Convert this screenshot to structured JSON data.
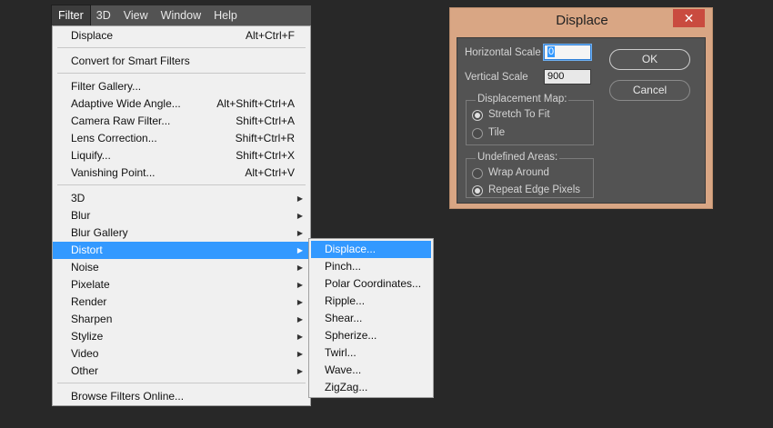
{
  "menubar": {
    "items": [
      "Filter",
      "3D",
      "View",
      "Window",
      "Help"
    ],
    "active": "Filter"
  },
  "filter_menu": {
    "last_filter": {
      "label": "Displace",
      "shortcut": "Alt+Ctrl+F"
    },
    "convert": {
      "label": "Convert for Smart Filters"
    },
    "group1": [
      {
        "label": "Filter Gallery...",
        "shortcut": ""
      },
      {
        "label": "Adaptive Wide Angle...",
        "shortcut": "Alt+Shift+Ctrl+A"
      },
      {
        "label": "Camera Raw Filter...",
        "shortcut": "Shift+Ctrl+A"
      },
      {
        "label": "Lens Correction...",
        "shortcut": "Shift+Ctrl+R"
      },
      {
        "label": "Liquify...",
        "shortcut": "Shift+Ctrl+X"
      },
      {
        "label": "Vanishing Point...",
        "shortcut": "Alt+Ctrl+V"
      }
    ],
    "submenus": [
      "3D",
      "Blur",
      "Blur Gallery",
      "Distort",
      "Noise",
      "Pixelate",
      "Render",
      "Sharpen",
      "Stylize",
      "Video",
      "Other"
    ],
    "highlighted": "Distort",
    "browse": {
      "label": "Browse Filters Online..."
    }
  },
  "distort_submenu": {
    "items": [
      "Displace...",
      "Pinch...",
      "Polar Coordinates...",
      "Ripple...",
      "Shear...",
      "Spherize...",
      "Twirl...",
      "Wave...",
      "ZigZag..."
    ],
    "highlighted": "Displace..."
  },
  "dialog": {
    "title": "Displace",
    "close_glyph": "✕",
    "horizontal_scale_label": "Horizontal Scale",
    "horizontal_scale_value": "0",
    "vertical_scale_label": "Vertical Scale",
    "vertical_scale_value": "900",
    "ok_label": "OK",
    "cancel_label": "Cancel",
    "displacement_map": {
      "title": "Displacement Map:",
      "options": [
        "Stretch To Fit",
        "Tile"
      ],
      "selected": "Stretch To Fit"
    },
    "undefined_areas": {
      "title": "Undefined Areas:",
      "options": [
        "Wrap Around",
        "Repeat Edge Pixels"
      ],
      "selected": "Repeat Edge Pixels"
    }
  },
  "colors": {
    "highlight": "#3399ff",
    "dialog_frame": "#d9a684",
    "close_button": "#c94b3f",
    "panel": "#535353",
    "background": "#282828"
  },
  "icons": {
    "submenu_arrow": "triangle-right-icon",
    "close": "close-icon"
  }
}
